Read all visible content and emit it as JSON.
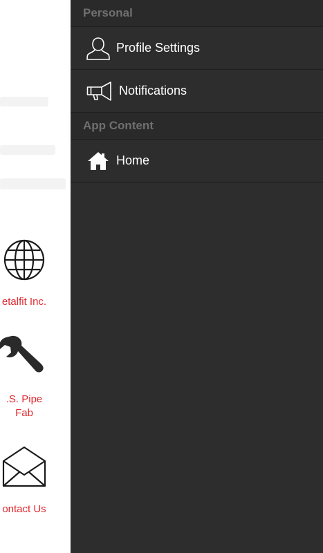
{
  "background_app": {
    "items": [
      {
        "icon": "globe-icon",
        "label": "etalfit Inc."
      },
      {
        "icon": "wrench-icon",
        "label": ".S. Pipe\nFab"
      },
      {
        "icon": "envelope-icon",
        "label": "ontact Us"
      }
    ],
    "label_color": "#e0282e"
  },
  "drawer": {
    "background": "#2d2d2d",
    "sections": [
      {
        "header": "Personal",
        "items": [
          {
            "label": "Profile Settings",
            "icon": "user-icon"
          },
          {
            "label": "Notifications",
            "icon": "megaphone-icon"
          }
        ]
      },
      {
        "header": "App Content",
        "items": [
          {
            "label": "Home",
            "icon": "home-icon"
          }
        ]
      }
    ]
  }
}
